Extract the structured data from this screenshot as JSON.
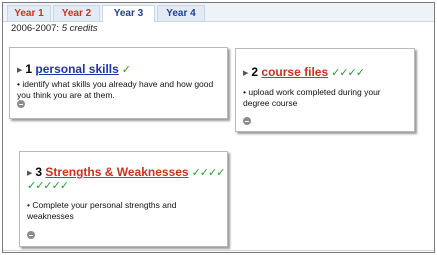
{
  "tabs": [
    {
      "label": "Year 1",
      "color": "#c8321e",
      "active": false
    },
    {
      "label": "Year 2",
      "color": "#c8321e",
      "active": false
    },
    {
      "label": "Year 3",
      "color": "#1f3f93",
      "active": true
    },
    {
      "label": "Year 4",
      "color": "#1f3f93",
      "active": false
    }
  ],
  "session": {
    "years": "2006-2007:",
    "credits": "5 credits"
  },
  "cards": [
    {
      "number": "1",
      "title": "personal skills",
      "ticks": "✓",
      "ticks_line2": "",
      "description": "• identify what skills you already have and how good you think you are at them."
    },
    {
      "number": "2",
      "title": "course files",
      "ticks": "✓✓✓✓",
      "ticks_line2": "",
      "description": "• upload work completed during your degree course"
    },
    {
      "number": "3",
      "title": "Strengths & Weaknesses",
      "ticks": "✓✓✓✓",
      "ticks_line2": "✓✓✓✓✓",
      "description": "• Complete your personal strengths and weaknesses"
    }
  ],
  "colors": {
    "tick": "#2c9a2c",
    "link_blue": "#2233aa",
    "link_red": "#c8321e"
  },
  "icons": {
    "expand": "triangle-right-icon",
    "collapse": "minus-circle-icon",
    "tick": "checkmark-icon"
  }
}
